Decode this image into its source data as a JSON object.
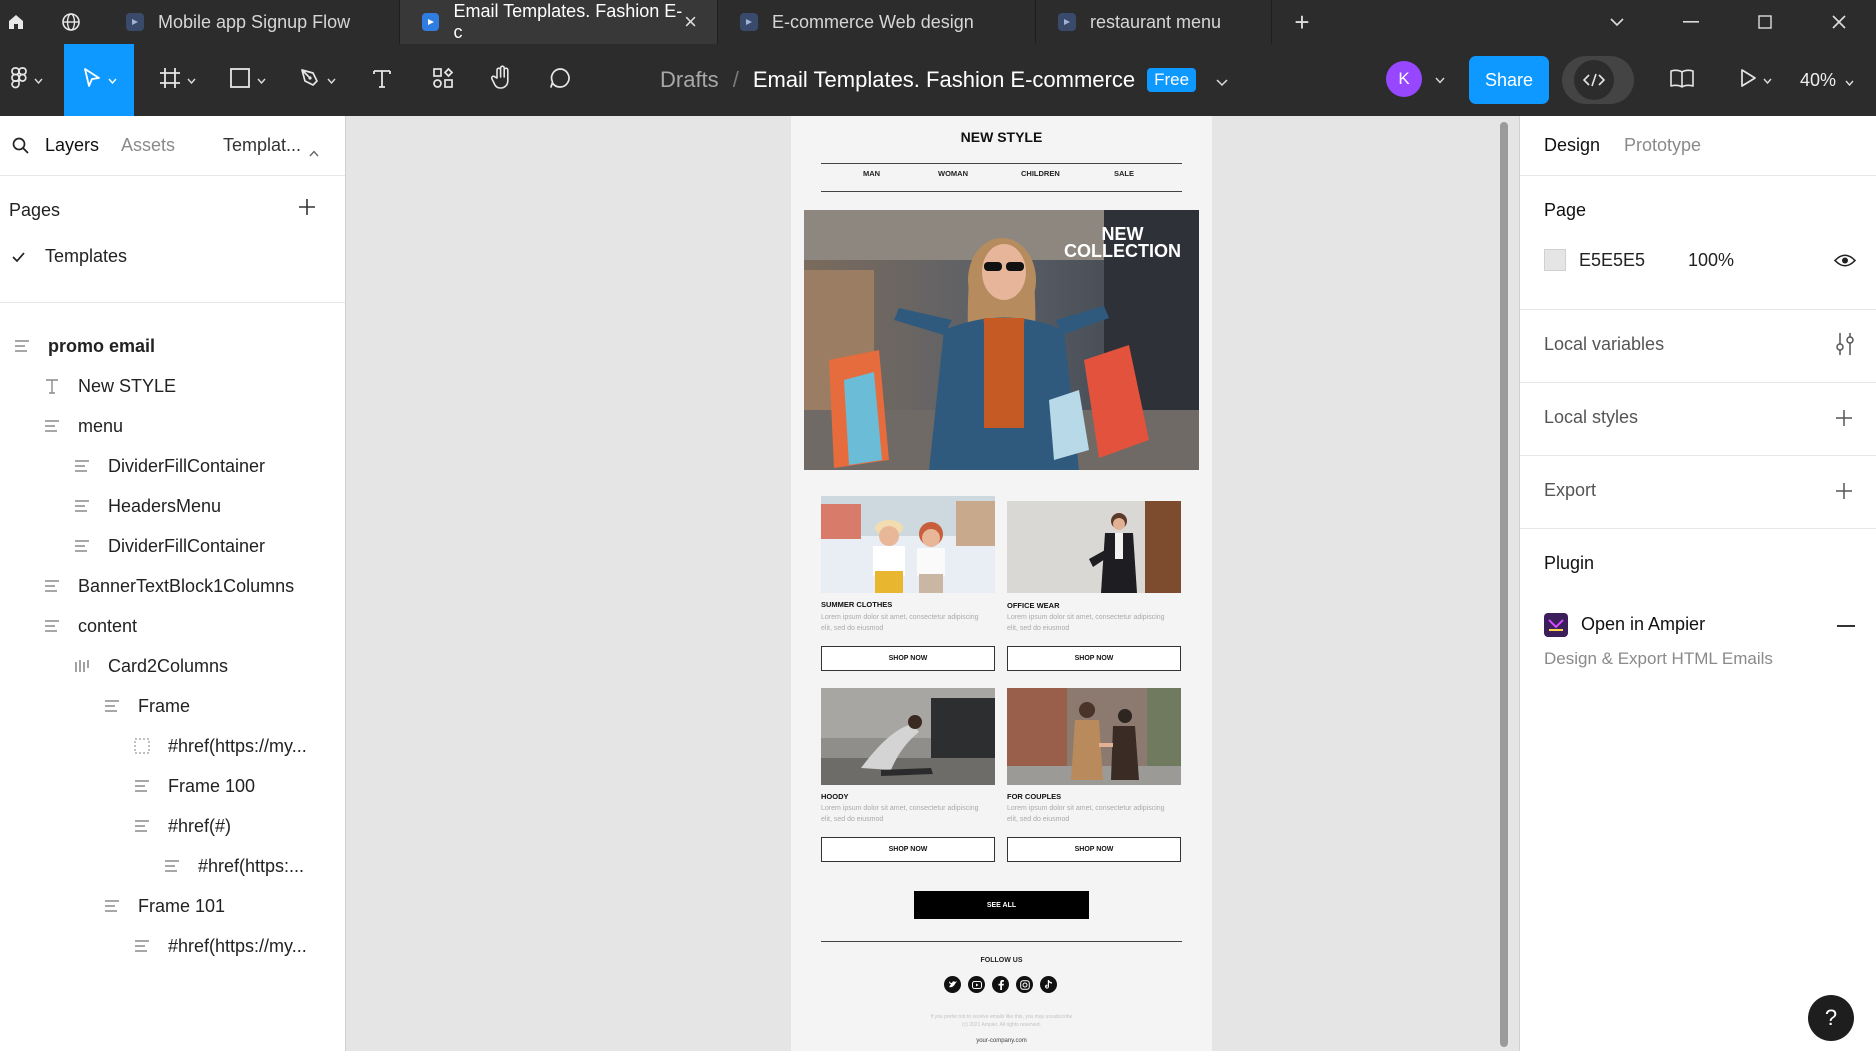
{
  "tabs": [
    {
      "label": "Mobile app Signup Flow",
      "active": false
    },
    {
      "label": "Email Templates. Fashion E-c",
      "active": true
    },
    {
      "label": "E-commerce Web design",
      "active": false
    },
    {
      "label": "restaurant menu",
      "active": false
    }
  ],
  "toolbar": {
    "breadcrumb_root": "Drafts",
    "breadcrumb_sep": "/",
    "file_name": "Email Templates. Fashion E-commerce",
    "plan_badge": "Free",
    "avatar_initial": "K",
    "share_label": "Share",
    "zoom": "40%"
  },
  "left_panel": {
    "tabs": [
      "Layers",
      "Assets",
      "Templat..."
    ],
    "pages_label": "Pages",
    "pages": [
      {
        "label": "Templates",
        "selected": true
      }
    ],
    "layers": [
      {
        "label": "promo email",
        "indent": 0,
        "icon": "frame-icon",
        "bold": true
      },
      {
        "label": "New STYLE",
        "indent": 1,
        "icon": "text-icon"
      },
      {
        "label": "menu",
        "indent": 1,
        "icon": "frame-icon"
      },
      {
        "label": "DividerFillContainer",
        "indent": 2,
        "icon": "frame-icon"
      },
      {
        "label": "HeadersMenu",
        "indent": 2,
        "icon": "frame-icon"
      },
      {
        "label": "DividerFillContainer",
        "indent": 2,
        "icon": "frame-icon"
      },
      {
        "label": "BannerTextBlock1Columns",
        "indent": 1,
        "icon": "frame-icon"
      },
      {
        "label": "content",
        "indent": 1,
        "icon": "frame-icon"
      },
      {
        "label": "Card2Columns",
        "indent": 2,
        "icon": "columns-icon"
      },
      {
        "label": "Frame",
        "indent": 3,
        "icon": "frame-icon"
      },
      {
        "label": "#href(https://my...",
        "indent": 4,
        "icon": "dashed-frame-icon"
      },
      {
        "label": "Frame 100",
        "indent": 4,
        "icon": "frame-icon"
      },
      {
        "label": "#href(#)",
        "indent": 4,
        "icon": "frame-icon"
      },
      {
        "label": "#href(https:...",
        "indent": 5,
        "icon": "frame-icon"
      },
      {
        "label": "Frame 101",
        "indent": 3,
        "icon": "frame-icon"
      },
      {
        "label": "#href(https://my...",
        "indent": 4,
        "icon": "frame-icon"
      }
    ]
  },
  "email": {
    "title": "NEW STYLE",
    "menu": [
      "MAN",
      "WOMAN",
      "CHILDREN",
      "SALE"
    ],
    "hero_text_line1": "NEW",
    "hero_text_line2": "COLLECTION",
    "cards": [
      {
        "title": "SUMMER CLOTHES",
        "text": "Lorem ipsum dolor sit amet, consectetur adipiscing elit, sed do eiusmod",
        "button": "SHOP NOW"
      },
      {
        "title": "OFFICE WEAR",
        "text": "Lorem ipsum dolor sit amet, consectetur adipiscing elit, sed do eiusmod",
        "button": "SHOP NOW"
      },
      {
        "title": "HOODY",
        "text": "Lorem ipsum dolor sit amet, consectetur adipiscing elit, sed do eiusmod",
        "button": "SHOP NOW"
      },
      {
        "title": "FOR COUPLES",
        "text": "Lorem ipsum dolor sit amet, consectetur adipiscing elit, sed do eiusmod",
        "button": "SHOP NOW"
      }
    ],
    "see_all": "SEE ALL",
    "follow_us": "FOLLOW US",
    "social_icons": [
      "twitter-icon",
      "youtube-icon",
      "facebook-icon",
      "instagram-icon",
      "tiktok-icon"
    ],
    "unsubscribe_line1": "If you prefer not to receive emails like this, you may unsubscribe",
    "unsubscribe_line2": "(c) 2021 Ampier. All rights reserved.",
    "company_url": "your-company.com"
  },
  "right_panel": {
    "tabs": [
      "Design",
      "Prototype"
    ],
    "page_label": "Page",
    "page_color": "E5E5E5",
    "page_opacity": "100%",
    "local_variables": "Local variables",
    "local_styles": "Local styles",
    "export": "Export",
    "plugin_label": "Plugin",
    "plugin_name": "Open in Ampier",
    "plugin_desc": "Design & Export HTML Emails"
  },
  "colors": {
    "accent": "#0d99ff",
    "avatar": "#9747ff",
    "toolbar_bg": "#2c2c2c",
    "canvas_bg": "#e5e5e5"
  }
}
